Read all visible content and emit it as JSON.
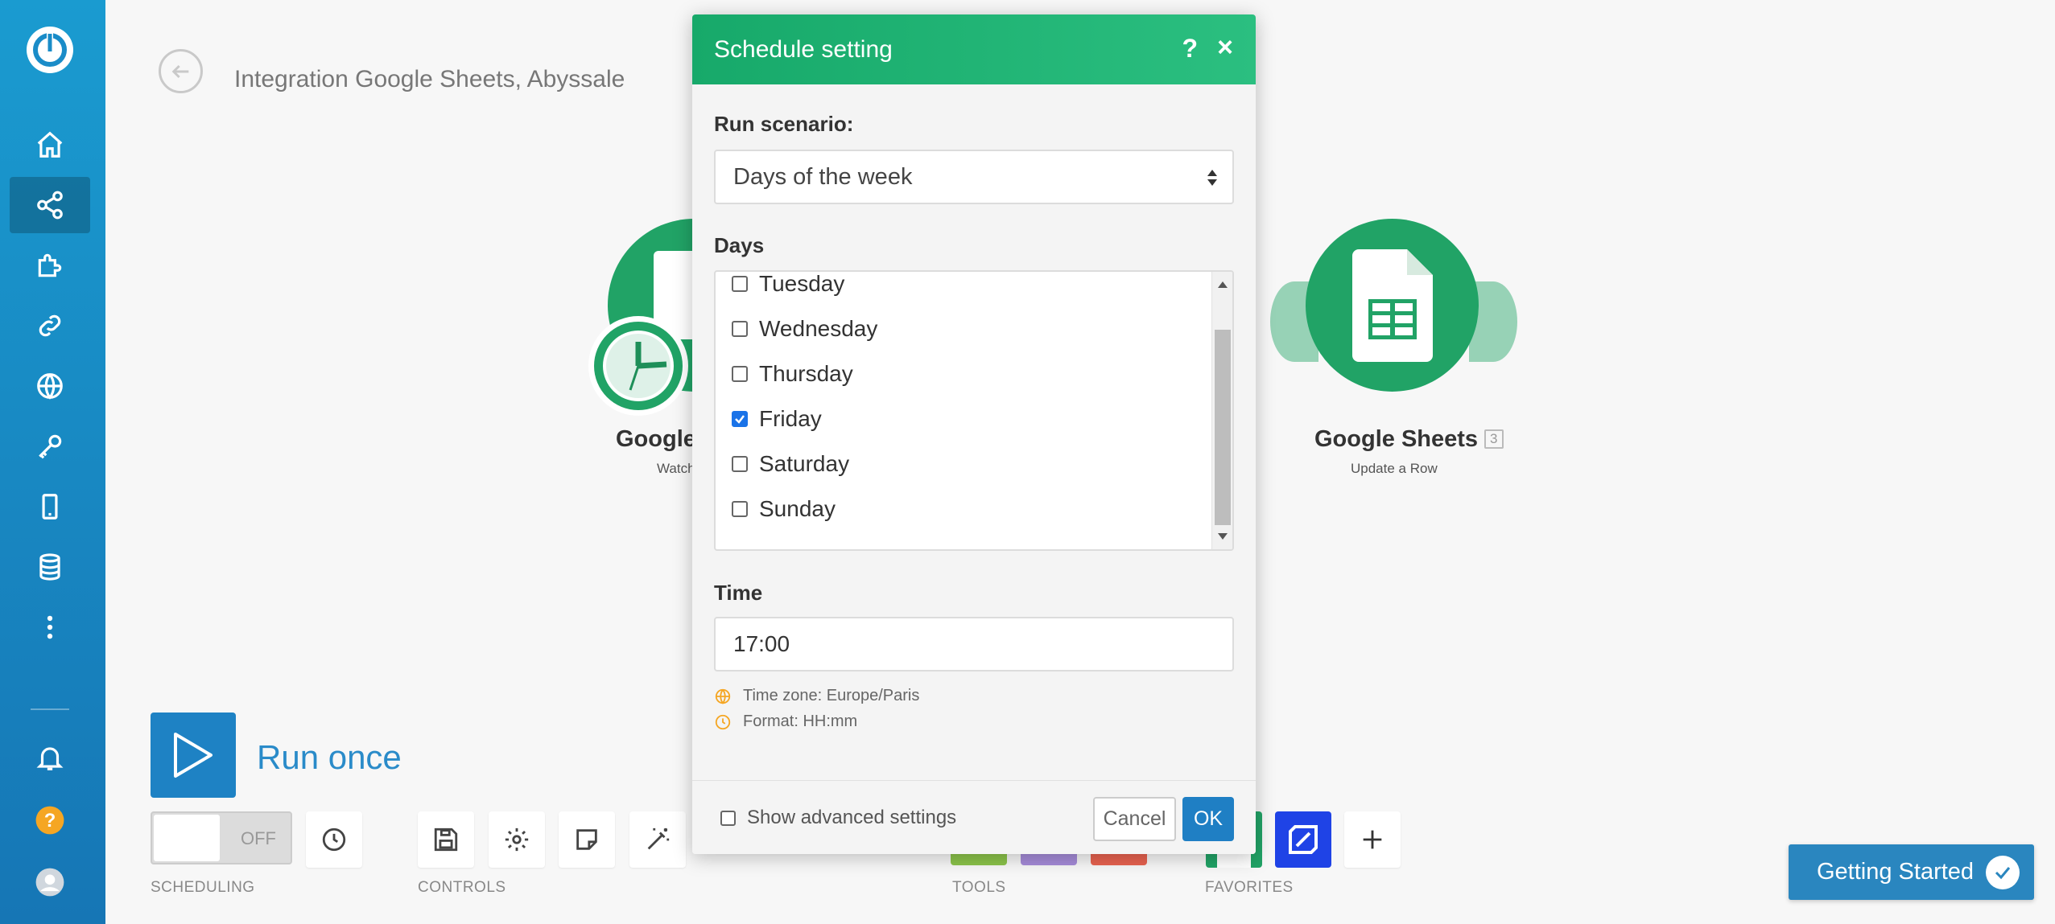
{
  "scenario": {
    "title": "Integration Google Sheets, Abyssale"
  },
  "canvas": {
    "module_left": {
      "name": "Google",
      "subtitle": "Watch"
    },
    "module_right": {
      "name": "Google Sheets",
      "badge": "3",
      "subtitle": "Update a Row"
    }
  },
  "run_once": {
    "label": "Run once"
  },
  "scheduling": {
    "toggle_state": "OFF",
    "section_label": "SCHEDULING"
  },
  "toolbar": {
    "controls_label": "CONTROLS",
    "tools_label": "TOOLS",
    "favorites_label": "FAVORITES"
  },
  "getting_started": {
    "label": "Getting Started"
  },
  "dialog": {
    "title": "Schedule setting",
    "help": "?",
    "close": "×",
    "run_label": "Run scenario:",
    "run_value": "Days of the week",
    "days_label": "Days",
    "days": [
      {
        "label": "Tuesday",
        "checked": false
      },
      {
        "label": "Wednesday",
        "checked": false
      },
      {
        "label": "Thursday",
        "checked": false
      },
      {
        "label": "Friday",
        "checked": true
      },
      {
        "label": "Saturday",
        "checked": false
      },
      {
        "label": "Sunday",
        "checked": false
      }
    ],
    "time_label": "Time",
    "time_value": "17:00",
    "timezone_hint": "Time zone: Europe/Paris",
    "format_hint": "Format: HH:mm",
    "advanced_label": "Show advanced settings",
    "cancel_label": "Cancel",
    "ok_label": "OK"
  },
  "colors": {
    "sidebar": "#1a8cc8",
    "dialog_header": "#1fb272",
    "primary": "#1f7fc4",
    "sheets_green": "#21a366"
  }
}
